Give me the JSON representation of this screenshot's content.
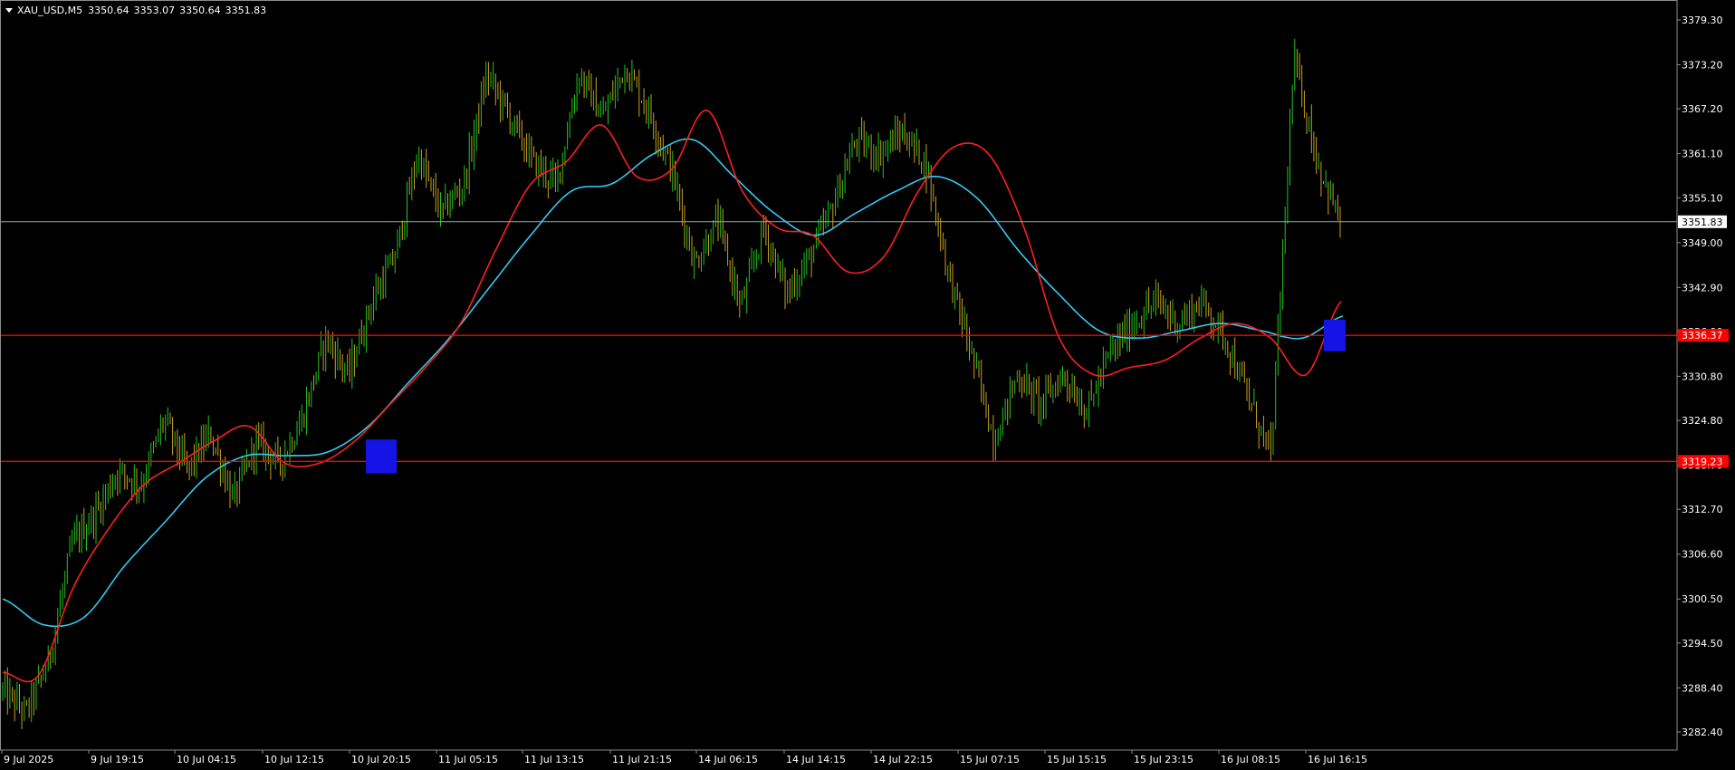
{
  "header": {
    "symbol_timeframe": "XAU_USD,M5",
    "open": "3350.64",
    "high": "3353.07",
    "low": "3350.64",
    "close": "3351.83"
  },
  "colors": {
    "background": "#000000",
    "grid_frame": "#8c8c8c",
    "candle_up": "#22c41f",
    "candle_down": "#c8a01e",
    "ma_fast": "#ff1f1f",
    "ma_slow": "#33c9f0",
    "level_line": "#ff0000",
    "current_price_line": "#8aa9b5",
    "zone_box": "#1414e6",
    "axis_text": "#ffffff",
    "level_label_bg": "#ff0000",
    "level_label_text": "#000000"
  },
  "chart_data": {
    "type": "candlestick",
    "title": "",
    "xlabel": "",
    "ylabel": "",
    "ylim": [
      3279.4,
      3382.0
    ],
    "grid": false,
    "legend": "none",
    "y_ticks": [
      "3379.30",
      "3373.20",
      "3367.20",
      "3361.10",
      "3355.10",
      "3349.00",
      "3342.90",
      "3336.90",
      "3330.80",
      "3324.80",
      "3318.70",
      "3312.70",
      "3306.60",
      "3300.50",
      "3294.50",
      "3288.40",
      "3282.40"
    ],
    "x_ticks": [
      "9 Jul 2025",
      "9 Jul 19:15",
      "10 Jul 04:15",
      "10 Jul 12:15",
      "10 Jul 20:15",
      "11 Jul 05:15",
      "11 Jul 13:15",
      "11 Jul 21:15",
      "14 Jul 06:15",
      "14 Jul 14:15",
      "14 Jul 22:15",
      "15 Jul 07:15",
      "15 Jul 15:15",
      "15 Jul 23:15",
      "16 Jul 08:15",
      "16 Jul 16:15"
    ],
    "price_path": [
      {
        "t": "9 Jul 2025",
        "price": 3288.0
      },
      {
        "t": "9 Jul 19:15",
        "price": 3312.0
      },
      {
        "t": "10 Jul 04:15",
        "price": 3318.0
      },
      {
        "t": "10 Jul 12:15",
        "price": 3322.0
      },
      {
        "t": "10 Jul 20:15",
        "price": 3319.0
      },
      {
        "t": "11 Jul 05:15",
        "price": 3333.0
      },
      {
        "t": "11 Jul 13:15",
        "price": 3360.0
      },
      {
        "t": "11 Jul 21:15",
        "price": 3366.0
      },
      {
        "t": "14 Jul 06:15",
        "price": 3361.0
      },
      {
        "t": "14 Jul 14:15",
        "price": 3356.0
      },
      {
        "t": "14 Jul 22:15",
        "price": 3345.0
      },
      {
        "t": "15 Jul 07:15",
        "price": 3361.0
      },
      {
        "t": "15 Jul 15:15",
        "price": 3345.0
      },
      {
        "t": "15 Jul 23:15",
        "price": 3332.0
      },
      {
        "t": "16 Jul 08:15",
        "price": 3338.0
      },
      {
        "t": "16 Jul 16:15",
        "price": 3351.83
      }
    ],
    "key_points": [
      {
        "price": 3288.0
      },
      {
        "price": 3285.0
      },
      {
        "price": 3292.0
      },
      {
        "price": 3308.0
      },
      {
        "price": 3312.0
      },
      {
        "price": 3318.0
      },
      {
        "price": 3316.0
      },
      {
        "price": 3325.0
      },
      {
        "price": 3318.0
      },
      {
        "price": 3323.0
      },
      {
        "price": 3314.0
      },
      {
        "price": 3322.0
      },
      {
        "price": 3319.0
      },
      {
        "price": 3325.0
      },
      {
        "price": 3336.0
      },
      {
        "price": 3331.0
      },
      {
        "price": 3341.0
      },
      {
        "price": 3347.0
      },
      {
        "price": 3361.0
      },
      {
        "price": 3353.0
      },
      {
        "price": 3357.0
      },
      {
        "price": 3372.0
      },
      {
        "price": 3366.0
      },
      {
        "price": 3360.0
      },
      {
        "price": 3357.0
      },
      {
        "price": 3372.0
      },
      {
        "price": 3366.0
      },
      {
        "price": 3373.0
      },
      {
        "price": 3367.0
      },
      {
        "price": 3359.0
      },
      {
        "price": 3346.0
      },
      {
        "price": 3352.0
      },
      {
        "price": 3340.0
      },
      {
        "price": 3351.0
      },
      {
        "price": 3342.0
      },
      {
        "price": 3347.0
      },
      {
        "price": 3354.0
      },
      {
        "price": 3363.0
      },
      {
        "price": 3361.0
      },
      {
        "price": 3364.0
      },
      {
        "price": 3360.0
      },
      {
        "price": 3345.0
      },
      {
        "price": 3334.0
      },
      {
        "price": 3322.0
      },
      {
        "price": 3331.0
      },
      {
        "price": 3327.0
      },
      {
        "price": 3331.0
      },
      {
        "price": 3326.0
      },
      {
        "price": 3334.0
      },
      {
        "price": 3338.0
      },
      {
        "price": 3341.0
      },
      {
        "price": 3338.0
      },
      {
        "price": 3341.0
      },
      {
        "price": 3336.0
      },
      {
        "price": 3328.0
      },
      {
        "price": 3320.0
      },
      {
        "price": 3374.0
      },
      {
        "price": 3360.0
      },
      {
        "price": 3351.83
      }
    ],
    "ma_fast_path": [
      3290.5,
      3290.0,
      3302.0,
      3310.0,
      3316.0,
      3319.0,
      3322.0,
      3324.0,
      3319.0,
      3319.0,
      3322.0,
      3327.0,
      3332.0,
      3338.0,
      3348.0,
      3357.0,
      3360.0,
      3365.0,
      3358.0,
      3359.0,
      3367.0,
      3356.0,
      3351.0,
      3350.0,
      3345.0,
      3347.0,
      3356.0,
      3362.0,
      3361.0,
      3351.0,
      3336.0,
      3331.0,
      3332.0,
      3333.0,
      3336.0,
      3338.0,
      3336.0,
      3331.0,
      3341.0
    ],
    "ma_slow_path": [
      3300.5,
      3297.0,
      3298.0,
      3305.0,
      3311.0,
      3317.0,
      3320.0,
      3320.0,
      3320.5,
      3324.0,
      3330.0,
      3336.0,
      3343.0,
      3350.0,
      3356.0,
      3357.0,
      3361.0,
      3363.0,
      3358.0,
      3353.0,
      3350.0,
      3353.0,
      3356.0,
      3358.0,
      3355.0,
      3348.0,
      3342.0,
      3337.0,
      3336.0,
      3337.0,
      3338.0,
      3337.0,
      3336.0,
      3339.0
    ],
    "horizontal_levels": [
      {
        "price": 3336.37,
        "label": "3336.37",
        "color": "#ff0000"
      },
      {
        "price": 3319.23,
        "label": "3319.23",
        "color": "#ff0000"
      }
    ],
    "current_price": {
      "price": 3351.83,
      "label": "3351.83"
    },
    "zones": [
      {
        "t_start": "10 Jul 20:15",
        "price_low": 3317.6,
        "price_high": 3322.2
      },
      {
        "t_start": "16 Jul 16:15",
        "price_low": 3334.2,
        "price_high": 3338.5
      }
    ]
  }
}
